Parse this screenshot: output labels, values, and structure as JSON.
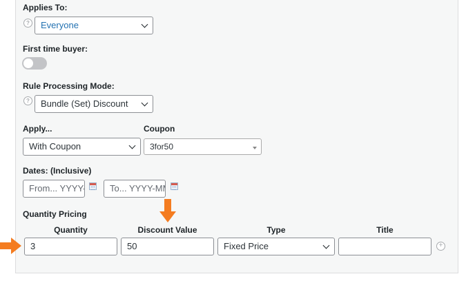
{
  "applies_to": {
    "label": "Applies To:",
    "value": "Everyone",
    "help_icon": "?"
  },
  "first_time_buyer": {
    "label": "First time buyer:",
    "enabled": false
  },
  "rule_processing": {
    "label": "Rule Processing Mode:",
    "value": "Bundle (Set) Discount",
    "help_icon": "?"
  },
  "apply": {
    "label": "Apply...",
    "value": "With Coupon"
  },
  "coupon": {
    "label": "Coupon",
    "value": "3for50"
  },
  "dates": {
    "label": "Dates: (Inclusive)",
    "from_placeholder": "From... YYYY-",
    "to_placeholder": "To... YYYY-MM"
  },
  "quantity_pricing": {
    "label": "Quantity Pricing",
    "columns": [
      "Quantity",
      "Discount Value",
      "Type",
      "Title"
    ],
    "row": {
      "quantity": "3",
      "discount_value": "50",
      "type": "Fixed Price",
      "title": ""
    },
    "add_icon": "+"
  },
  "colors": {
    "arrow": "#f47c20",
    "panel_bg": "#f6f7f7",
    "selected_text_link": "#2271b1"
  }
}
